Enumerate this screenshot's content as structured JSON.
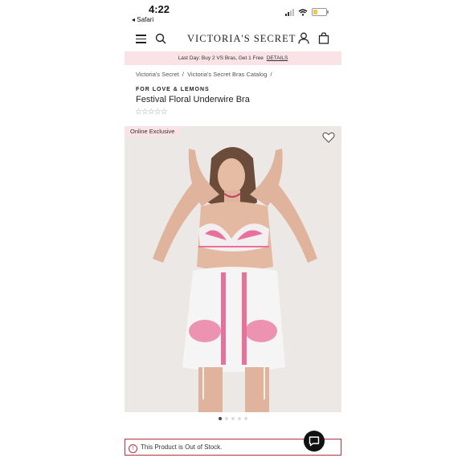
{
  "status_bar": {
    "time": "4:22",
    "back_app": "◂ Safari"
  },
  "header": {
    "logo": "VICTORIA'S SECRET"
  },
  "promo": {
    "text": "Last Day: Buy 2 VS Bras, Get 1 Free",
    "link": "DETAILS"
  },
  "breadcrumb": {
    "items": [
      "Victoria's Secret",
      "Victoria's Secret Bras Catalog"
    ],
    "separator": "/"
  },
  "product": {
    "brand": "FOR LOVE & LEMONS",
    "title": "Festival Floral Underwire Bra",
    "rating_stars": "☆☆☆☆☆",
    "badge": "Online Exclusive",
    "image_count": 5,
    "active_image": 1
  },
  "stock": {
    "message": "This Product is Out of Stock.",
    "icon": "!"
  },
  "icons": [
    "hamburger-icon",
    "search-icon",
    "account-icon",
    "bag-icon",
    "heart-icon",
    "info-icon",
    "chat-icon"
  ],
  "colors": {
    "promo_bg": "#f9e3e6",
    "error_border": "#b4343d",
    "accent_pink": "#e8719b"
  }
}
